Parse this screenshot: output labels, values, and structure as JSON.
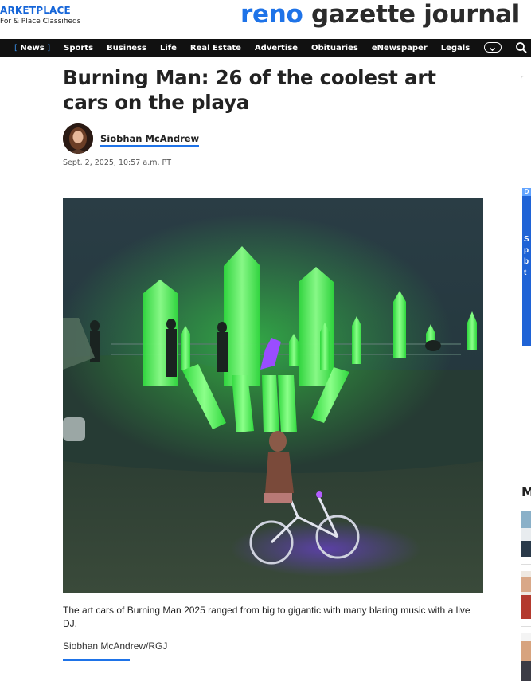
{
  "header": {
    "marketplace_title": "ARKETPLACE",
    "marketplace_subtitle": "For & Place Classifieds",
    "logo_part1": "reno",
    "logo_part2": " gazette journal"
  },
  "nav": {
    "active_left_bracket": "[",
    "active_label": "News",
    "active_right_bracket": "]",
    "items": [
      "Sports",
      "Business",
      "Life",
      "Real Estate",
      "Advertise",
      "Obituaries",
      "eNewspaper",
      "Legals"
    ]
  },
  "icons": {
    "more": "chevron-down-icon",
    "search": "search-icon"
  },
  "article": {
    "headline": "Burning Man: 26 of the coolest art cars on the playa",
    "author": "Siobhan McAndrew",
    "date": "Sept. 2, 2025, 10:57 a.m. PT",
    "photo_caption": "The art cars of Burning Man 2025 ranged from big to gigantic with many blaring music with a live DJ.",
    "photo_credit": "Siobhan McAndrew/RGJ"
  },
  "rail": {
    "ad_marker": "D",
    "ad_text": [
      "S",
      "p",
      "b",
      "t"
    ],
    "section_heading": "M"
  },
  "colors": {
    "brand_blue": "#1e73e8",
    "nav_background": "#111111",
    "crystal_green": "#4dff5a"
  }
}
